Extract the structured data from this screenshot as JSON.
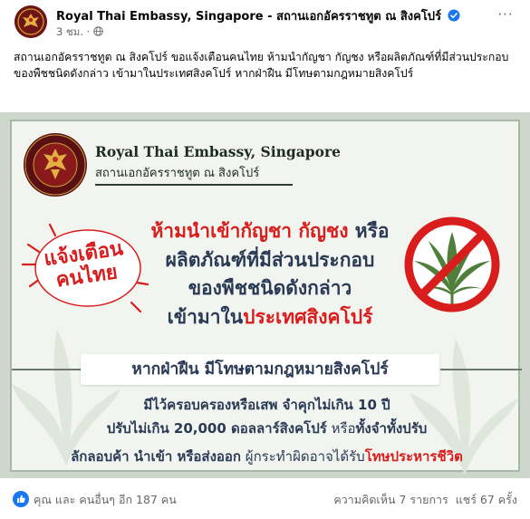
{
  "post": {
    "page_name": "Royal Thai Embassy, Singapore - สถานเอกอัครราชทูต ณ สิงคโปร์",
    "time": "3 ชม.",
    "separator": "·",
    "more_label": "···",
    "caption": "สถานเอกอัครราชทูต ณ สิงคโปร์ ขอแจ้งเตือนคนไทย ห้ามนำกัญชา กัญชง หรือผลิตภัณฑ์ที่มีส่วนประกอบของพืชชนิดดังกล่าว เข้ามาในประเทศสิงคโปร์ หากฝ่าฝืน มีโทษตามกฎหมายสิงคโปร์",
    "colors": {
      "accent_red": "#d91c1c",
      "navy": "#2a3a55",
      "card_bg": "#f1f4ef",
      "verified_blue": "#1877f2"
    },
    "icons": [
      "verified-badge-icon",
      "globe-icon",
      "more-options-icon",
      "like-reaction-icon",
      "no-cannabis-icon"
    ]
  },
  "card": {
    "org_en": "Royal Thai Embassy, Singapore",
    "org_th": "สถานเอกอัครราชทูต ณ สิงคโปร์",
    "badge_line1": "แจ้งเตือน",
    "badge_line2": "คนไทย",
    "warn_line1_red": "ห้ามนำเข้ากัญชา กัญชง ",
    "warn_line1_rest": "หรือ",
    "warn_line2": "ผลิตภัณฑ์ที่มีส่วนประกอบ",
    "warn_line3": "ของพืชชนิดดังกล่าว",
    "warn_line4_a": "เข้ามาใน",
    "warn_line4_red": "ประเทศสิงคโปร์",
    "penalty_title": "หากฝ่าฝืน มีโทษตามกฎหมายสิงคโปร์",
    "p1_a": "มีไว้ครอบครองหรือเสพ",
    "p1_b": " จำคุกไม่เกิน 10 ปี",
    "p2_a": "ปรับไม่เกิน 20,000 ดอลลาร์สิงคโปร์",
    "p2_b": " หรือ",
    "p2_c": "ทั้งจำทั้งปรับ",
    "p3_a": "ลักลอบค้า นำเข้า หรือส่งออก",
    "p3_b": " ผู้กระทำผิดอาจได้รับ",
    "p3_c": "โทษประหารชีวิต"
  },
  "footer": {
    "reactions_text": "คุณ และ คนอื่นๆ อีก 187 คน",
    "comments": "ความคิดเห็น 7 รายการ",
    "shares": "แชร์ 67 ครั้ง"
  }
}
